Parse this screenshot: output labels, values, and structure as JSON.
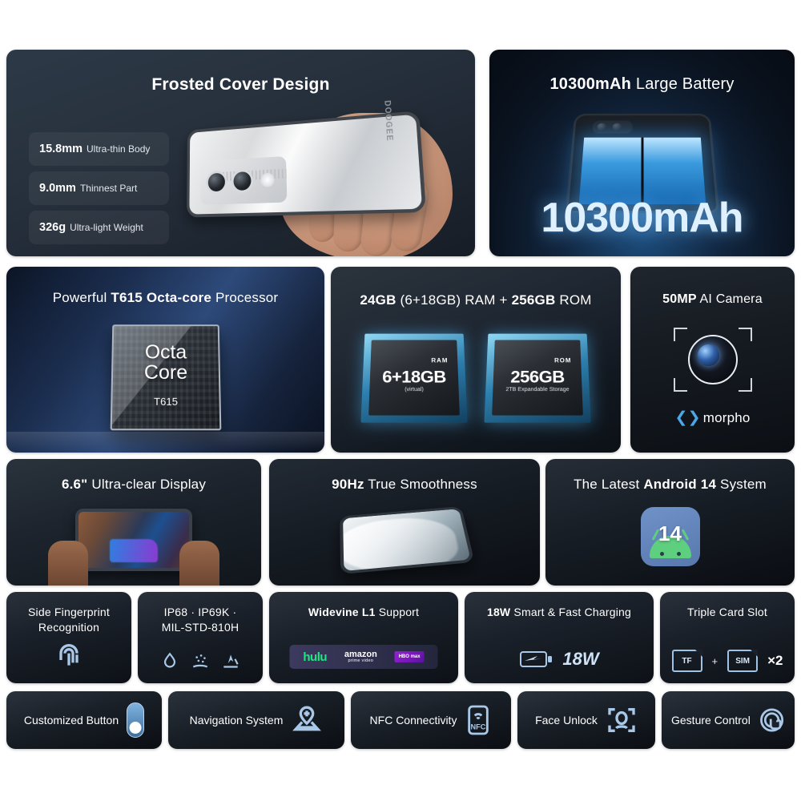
{
  "background": "#ffffff",
  "accent": "#a9c8e8",
  "cards": {
    "frosted": {
      "title_html": "Frosted Cover Design",
      "title": "Frosted Cover Design",
      "specs": [
        {
          "value": "15.8mm",
          "label": "Ultra-thin Body"
        },
        {
          "value": "9.0mm",
          "label": "Thinnest Part"
        },
        {
          "value": "326g",
          "label": "Ultra-light Weight"
        }
      ],
      "phone_brand": "DOOGEE"
    },
    "battery": {
      "title_bold": "10300mAh",
      "title_rest": " Large Battery",
      "hero_text": "10300mAh"
    },
    "processor": {
      "title_pre": "Powerful ",
      "title_bold": "T615 Octa-core",
      "title_post": " Processor",
      "chip_line1": "Octa",
      "chip_line2": "Core",
      "chip_model": "T615"
    },
    "memory": {
      "title_bold1": "24GB",
      "title_mid": " (6+18GB) RAM + ",
      "title_bold2": "256GB",
      "title_post": " ROM",
      "chips": [
        {
          "kind": "RAM",
          "value": "6+18GB",
          "note": "(virtual)"
        },
        {
          "kind": "ROM",
          "value": "256GB",
          "note": "2TB Expandable Storage"
        }
      ]
    },
    "camera": {
      "title_bold": "50MP",
      "title_rest": " AI Camera",
      "partner_logo": "morpho"
    },
    "display": {
      "title_bold": "6.6\"",
      "title_rest": " Ultra-clear Display"
    },
    "refresh": {
      "title_bold": "90Hz",
      "title_rest": " True Smoothness"
    },
    "android": {
      "title_pre": "The Latest ",
      "title_bold": "Android 14",
      "title_post": " System",
      "badge_number": "14"
    },
    "fingerprint": {
      "title": "Side Fingerprint Recognition"
    },
    "durability": {
      "title_line1": "IP68 · IP69K ·",
      "title_line2": "MIL-STD-810H",
      "icons": [
        "water-drop-icon",
        "dust-icon",
        "drop-impact-icon"
      ]
    },
    "widevine": {
      "title_bold": "Widevine L1",
      "title_rest": " Support",
      "logos": [
        {
          "name": "hulu",
          "text": "hulu"
        },
        {
          "name": "amazon-prime-video",
          "text": "amazon",
          "sub": "prime video"
        },
        {
          "name": "hbo-max",
          "text": "HBO",
          "sub": "max"
        }
      ]
    },
    "charging": {
      "title_bold": "18W",
      "title_rest": " Smart & Fast Charging",
      "badge": "18W"
    },
    "cardslot": {
      "title": "Triple Card Slot",
      "slot1": "TF",
      "plus": "+",
      "slot2": "SIM",
      "multiplier": "×2"
    }
  },
  "features": [
    {
      "label": "Customized Button",
      "icon": "toggle-switch-icon"
    },
    {
      "label": "Navigation System",
      "icon": "map-pin-icon"
    },
    {
      "label": "NFC Connectivity",
      "icon": "nfc-icon"
    },
    {
      "label": "Face Unlock",
      "icon": "face-scan-icon"
    },
    {
      "label": "Gesture Control",
      "icon": "touch-gesture-icon"
    }
  ]
}
